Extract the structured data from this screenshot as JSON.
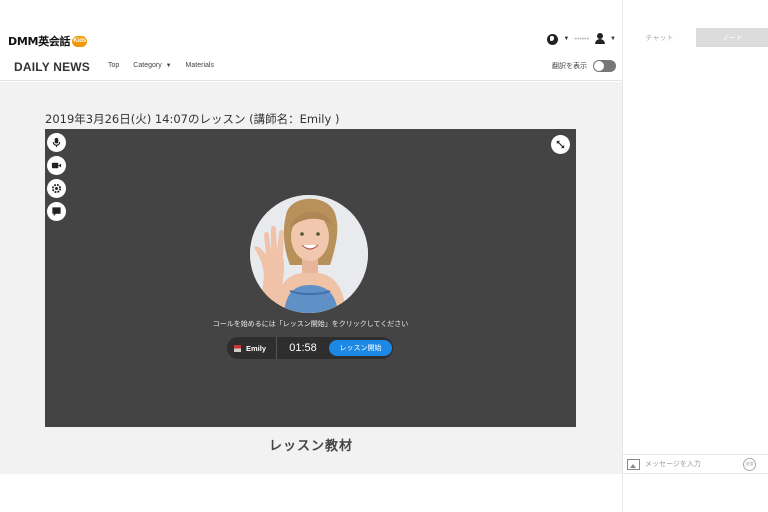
{
  "header": {
    "logo_text": "DMM英会話",
    "logo_badge": "Kids",
    "username": "••••••",
    "site_title": "DAILY NEWS",
    "nav": [
      "Top",
      "Category",
      "Materials"
    ],
    "category_caret": "▼",
    "translation_toggle": {
      "label": "翻訳を表示",
      "on": false
    }
  },
  "lesson": {
    "heading": "2019年3月26日(火) 14:07のレッスン (講師名：Emily )",
    "prompt": "コールを始めるには「レッスン開始」をクリックしてください",
    "tutor_name": "Emily",
    "timer": "01:58",
    "start_button": "レッスン開始",
    "materials_title": "レッスン教材"
  },
  "sidepanel": {
    "tabs": [
      "チャット",
      "ノート"
    ],
    "active_tab": "ノート",
    "message_placeholder": "メッセージを入力",
    "send_label": "送信"
  },
  "icons": [
    "globe-icon",
    "user-icon",
    "microphone-icon",
    "camera-icon",
    "settings-icon",
    "chat-icon",
    "expand-icon",
    "image-icon",
    "send-icon"
  ],
  "colors": {
    "start_button": "#1e88e5",
    "video_bg": "#444444",
    "logo_badge": "#f39800"
  }
}
